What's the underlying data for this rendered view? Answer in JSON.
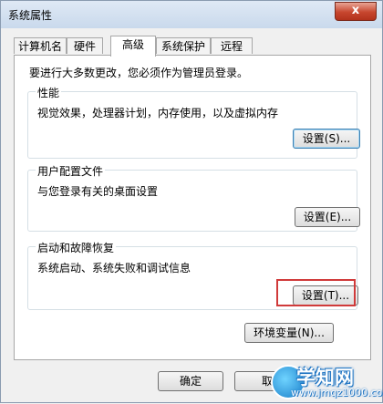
{
  "window": {
    "title": "系统属性",
    "close_symbol": "x"
  },
  "tabs": [
    "计算机名",
    "硬件",
    "高级",
    "系统保护",
    "远程"
  ],
  "intro": "要进行大多数更改，您必须作为管理员登录。",
  "groups": [
    {
      "title": "性能",
      "desc": "视觉效果，处理器计划，内存使用，以及虚拟内存",
      "button": "设置(S)..."
    },
    {
      "title": "用户配置文件",
      "desc": "与您登录有关的桌面设置",
      "button": "设置(E)..."
    },
    {
      "title": "启动和故障恢复",
      "desc": "系统启动、系统失败和调试信息",
      "button": "设置(T)..."
    }
  ],
  "env_button": "环境变量(N)...",
  "ok_button": "确定",
  "cancel_button": "取",
  "watermark": {
    "title": "学知网",
    "url": "www.jmqz1000.com"
  }
}
